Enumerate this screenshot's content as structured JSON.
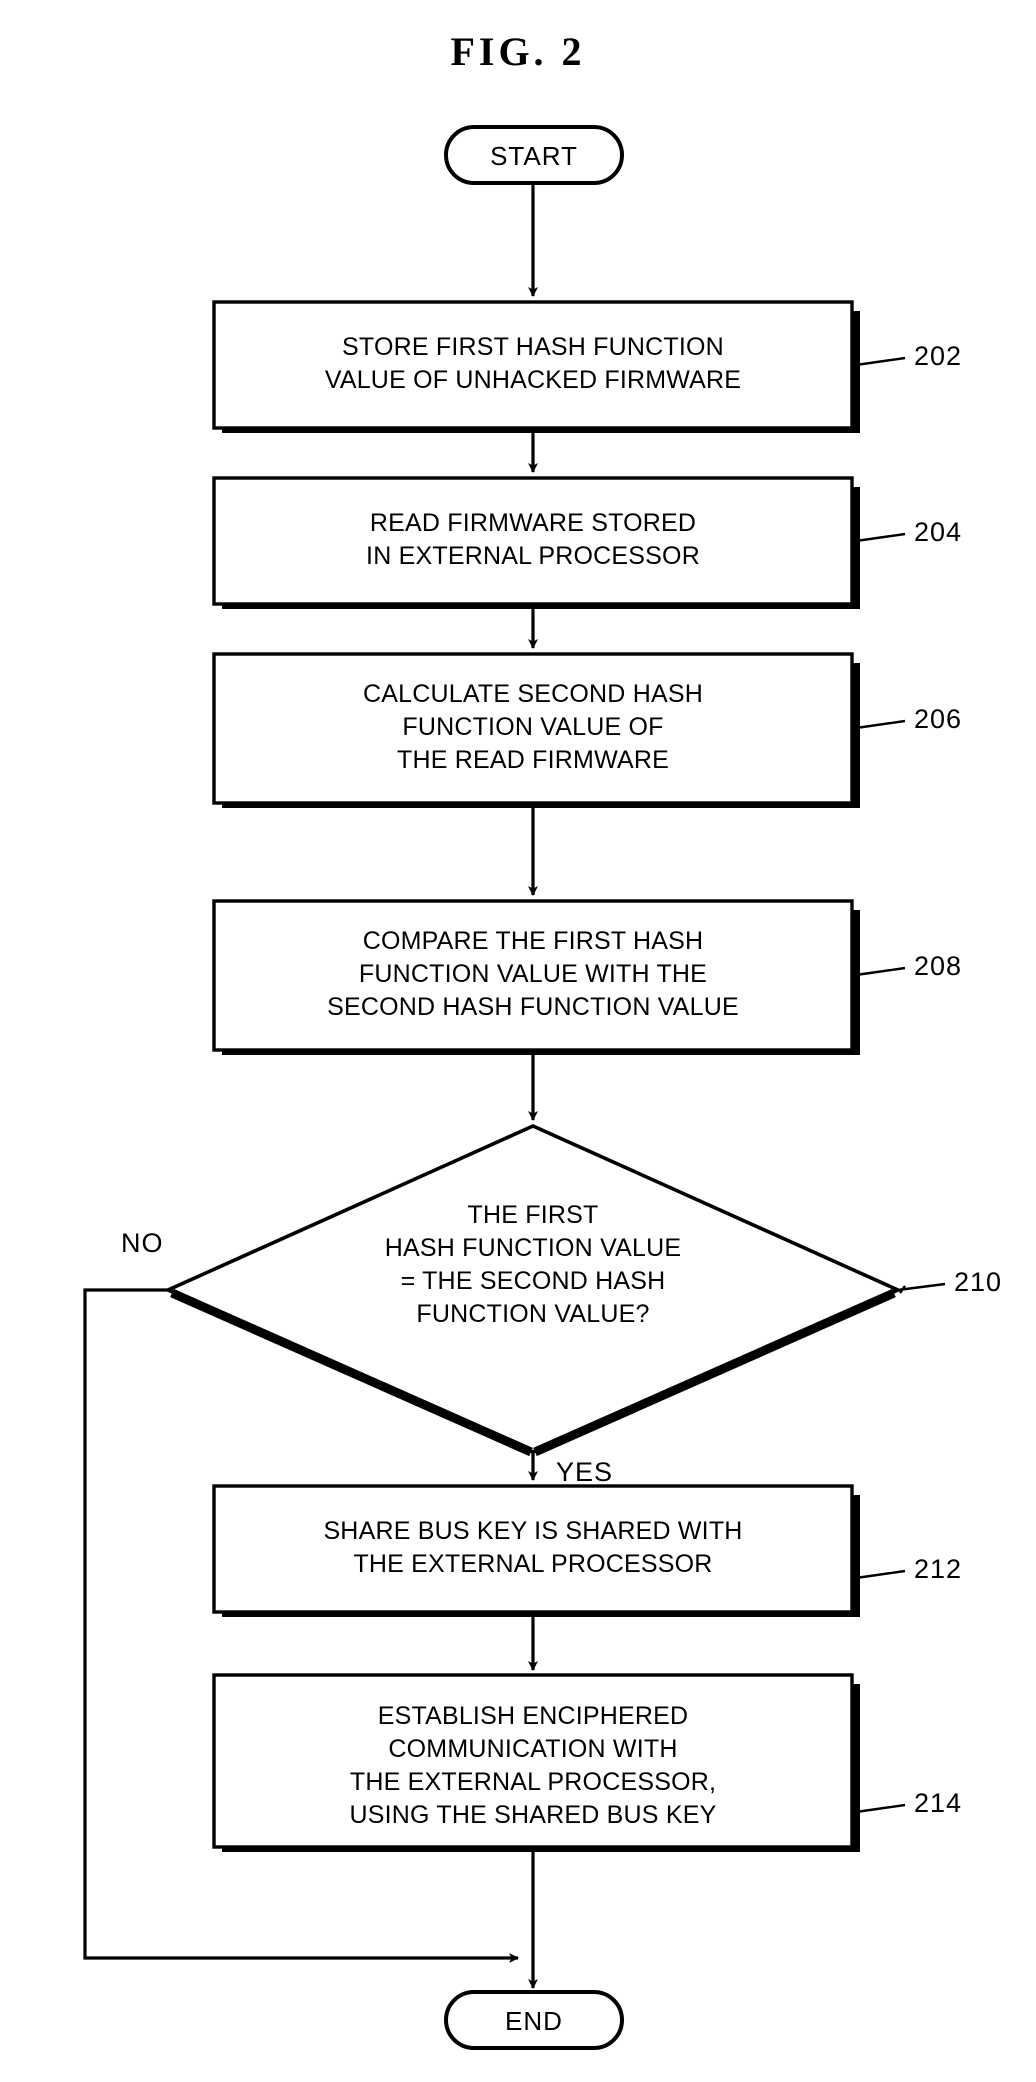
{
  "figure": {
    "title": "FIG.  2",
    "type": "flowchart"
  },
  "chart_data": {
    "type": "diagram",
    "title": "FIG.  2",
    "nodes": [
      {
        "id": "start",
        "shape": "terminal",
        "label": "START",
        "ref": ""
      },
      {
        "id": "s202",
        "shape": "process",
        "label": "STORE FIRST HASH FUNCTION\nVALUE OF UNHACKED FIRMWARE",
        "ref": "202"
      },
      {
        "id": "s204",
        "shape": "process",
        "label": "READ FIRMWARE STORED\nIN EXTERNAL PROCESSOR",
        "ref": "204"
      },
      {
        "id": "s206",
        "shape": "process",
        "label": "CALCULATE SECOND HASH\nFUNCTION VALUE OF\nTHE READ FIRMWARE",
        "ref": "206"
      },
      {
        "id": "s208",
        "shape": "process",
        "label": "COMPARE THE FIRST HASH\nFUNCTION VALUE WITH THE\nSECOND HASH FUNCTION VALUE",
        "ref": "208"
      },
      {
        "id": "s210",
        "shape": "decision",
        "label": "THE FIRST\nHASH FUNCTION VALUE\n= THE SECOND HASH\nFUNCTION VALUE?",
        "ref": "210"
      },
      {
        "id": "s212",
        "shape": "process",
        "label": "SHARE BUS KEY IS SHARED WITH\nTHE EXTERNAL PROCESSOR",
        "ref": "212"
      },
      {
        "id": "s214",
        "shape": "process",
        "label": "ESTABLISH ENCIPHERED\nCOMMUNICATION WITH\nTHE EXTERNAL PROCESSOR,\nUSING THE SHARED BUS KEY",
        "ref": "214"
      },
      {
        "id": "end",
        "shape": "terminal",
        "label": "END",
        "ref": ""
      }
    ],
    "edges": [
      {
        "from": "start",
        "to": "s202",
        "label": ""
      },
      {
        "from": "s202",
        "to": "s204",
        "label": ""
      },
      {
        "from": "s204",
        "to": "s206",
        "label": ""
      },
      {
        "from": "s206",
        "to": "s208",
        "label": ""
      },
      {
        "from": "s208",
        "to": "s210",
        "label": ""
      },
      {
        "from": "s210",
        "to": "s212",
        "label": "YES"
      },
      {
        "from": "s210",
        "to": "end",
        "label": "NO"
      },
      {
        "from": "s212",
        "to": "s214",
        "label": ""
      },
      {
        "from": "s214",
        "to": "end",
        "label": ""
      }
    ],
    "branch_labels": {
      "no": "NO",
      "yes": "YES"
    },
    "reference_numerals": [
      "202",
      "204",
      "206",
      "208",
      "210",
      "212",
      "214"
    ],
    "colors": {
      "stroke": "#000000",
      "fill": "#ffffff",
      "background": "#ffffff"
    }
  },
  "nodes": {
    "start": {
      "label": "START"
    },
    "s202": {
      "label": "STORE FIRST HASH FUNCTION\nVALUE OF UNHACKED FIRMWARE",
      "ref": "202"
    },
    "s204": {
      "label": "READ FIRMWARE STORED\nIN EXTERNAL PROCESSOR",
      "ref": "204"
    },
    "s206": {
      "label": "CALCULATE SECOND HASH\nFUNCTION VALUE OF\nTHE READ FIRMWARE",
      "ref": "206"
    },
    "s208": {
      "label": "COMPARE THE FIRST HASH\nFUNCTION VALUE WITH THE\nSECOND HASH FUNCTION VALUE",
      "ref": "208"
    },
    "s210": {
      "label": "THE FIRST\nHASH FUNCTION VALUE\n= THE SECOND HASH\nFUNCTION VALUE?",
      "ref": "210"
    },
    "s212": {
      "label": "SHARE BUS KEY IS SHARED WITH\nTHE EXTERNAL PROCESSOR",
      "ref": "212"
    },
    "s214": {
      "label": "ESTABLISH ENCIPHERED\nCOMMUNICATION WITH\nTHE EXTERNAL PROCESSOR,\nUSING THE SHARED BUS KEY",
      "ref": "214"
    },
    "end": {
      "label": "END"
    }
  },
  "labels": {
    "no": "NO",
    "yes": "YES"
  }
}
